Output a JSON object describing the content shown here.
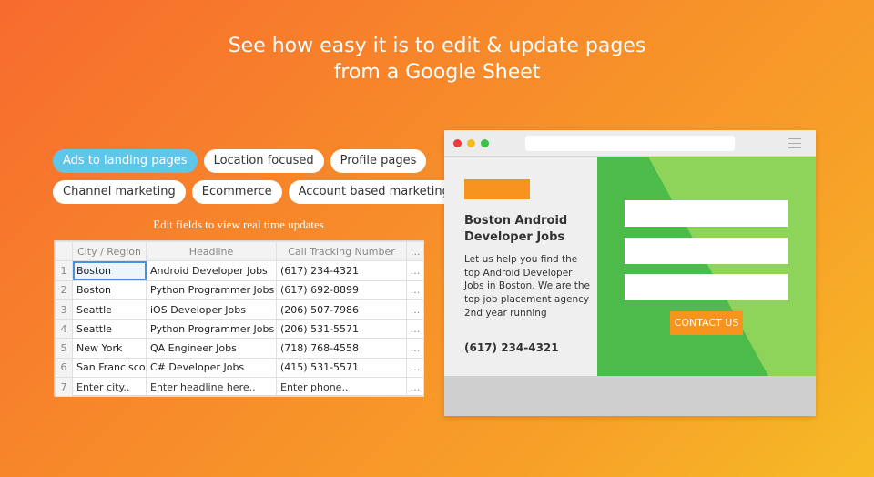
{
  "headline": {
    "line1": "See how easy it is to edit & update pages",
    "line2": "from a Google Sheet"
  },
  "chips": {
    "row1": [
      "Ads to landing pages",
      "Location focused",
      "Profile pages"
    ],
    "row2": [
      "Channel marketing",
      "Ecommerce",
      "Account based marketing"
    ],
    "active": "Ads to landing pages"
  },
  "sheet": {
    "caption": "Edit fields to view real time updates",
    "columns": [
      "City / Region",
      "Headline",
      "Call Tracking Number",
      "..."
    ],
    "rows": [
      {
        "num": "1",
        "city": "Boston",
        "headline": "Android Developer Jobs",
        "phone": "(617) 234-4321",
        "more": "..."
      },
      {
        "num": "2",
        "city": "Boston",
        "headline": "Python Programmer Jobs",
        "phone": "(617) 692-8899",
        "more": "..."
      },
      {
        "num": "3",
        "city": "Seattle",
        "headline": "iOS Developer Jobs",
        "phone": "(206) 507-7986",
        "more": "..."
      },
      {
        "num": "4",
        "city": "Seattle",
        "headline": "Python Programmer Jobs",
        "phone": "(206) 531-5571",
        "more": "..."
      },
      {
        "num": "5",
        "city": "New York",
        "headline": "QA Engineer Jobs",
        "phone": "(718) 768-4558",
        "more": "..."
      },
      {
        "num": "6",
        "city": "San Francisco",
        "headline": "C# Developer Jobs",
        "phone": "(415) 531-5571",
        "more": "..."
      },
      {
        "num": "7",
        "city": "Enter city..",
        "headline": "Enter headline here..",
        "phone": "Enter phone..",
        "more": "..."
      }
    ]
  },
  "preview": {
    "title": "Boston Android Developer Jobs",
    "body": "Let us help you find the top Android Developer Jobs in Boston. We are the top job placement agency 2nd year running",
    "phone": "(617) 234-4321",
    "button": "CONTACT US",
    "icons": [
      "close-dot",
      "minimize-dot",
      "maximize-dot",
      "hamburger-menu-icon"
    ],
    "colors": {
      "accent": "#f7941d",
      "green_dark": "#4cbb4a",
      "green_light": "#8fd45a"
    }
  }
}
